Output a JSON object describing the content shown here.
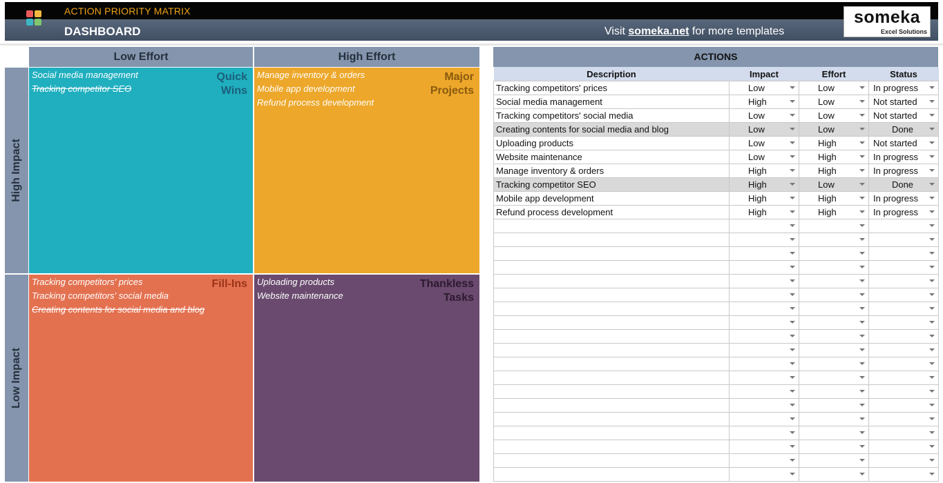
{
  "header": {
    "app_title": "ACTION PRIORITY MATRIX",
    "page_title": "DASHBOARD",
    "promo_prefix": "Visit ",
    "promo_link": "someka.net",
    "promo_suffix": " for more templates",
    "brand_name": "someka",
    "brand_sub": "Excel Solutions",
    "accent_color": "#f0a316",
    "header_color": "#4a596c"
  },
  "matrix": {
    "columns": [
      "Low Effort",
      "High Effort"
    ],
    "rows": [
      "High Impact",
      "Low Impact"
    ],
    "quadrants": [
      {
        "title": "Quick Wins",
        "color": "#20afbf",
        "title_color": "#1b5f7a",
        "items": [
          {
            "text": "Social media management",
            "done": false
          },
          {
            "text": "Tracking competitor SEO",
            "done": true
          }
        ]
      },
      {
        "title": "Major Projects",
        "color": "#eda72a",
        "title_color": "#8a5a10",
        "items": [
          {
            "text": "Manage inventory & orders",
            "done": false
          },
          {
            "text": "Mobile app development",
            "done": false
          },
          {
            "text": "Refund process development",
            "done": false
          }
        ]
      },
      {
        "title": "Fill-Ins",
        "color": "#e37150",
        "title_color": "#9b3418",
        "items": [
          {
            "text": "Tracking competitors' prices",
            "done": false
          },
          {
            "text": "Tracking competitors' social media",
            "done": false
          },
          {
            "text": "Creating contents for social media and blog",
            "done": true
          }
        ]
      },
      {
        "title": "Thankless Tasks",
        "color": "#6a4a6e",
        "title_color": "#2d1a30",
        "items": [
          {
            "text": "Uploading products",
            "done": false
          },
          {
            "text": "Website maintenance",
            "done": false
          }
        ]
      }
    ]
  },
  "actions": {
    "title": "ACTIONS",
    "columns": [
      "Description",
      "Impact",
      "Effort",
      "Status"
    ],
    "rows": [
      {
        "description": "Tracking competitors' prices",
        "impact": "Low",
        "effort": "Low",
        "status": "In progress"
      },
      {
        "description": "Social media management",
        "impact": "High",
        "effort": "Low",
        "status": "Not started"
      },
      {
        "description": "Tracking competitors' social media",
        "impact": "Low",
        "effort": "Low",
        "status": "Not started"
      },
      {
        "description": "Creating contents for social media and blog",
        "impact": "Low",
        "effort": "Low",
        "status": "Done"
      },
      {
        "description": "Uploading products",
        "impact": "Low",
        "effort": "High",
        "status": "Not started"
      },
      {
        "description": "Website maintenance",
        "impact": "Low",
        "effort": "High",
        "status": "In progress"
      },
      {
        "description": "Manage inventory & orders",
        "impact": "High",
        "effort": "High",
        "status": "In progress"
      },
      {
        "description": "Tracking competitor SEO",
        "impact": "High",
        "effort": "Low",
        "status": "Done"
      },
      {
        "description": "Mobile app development",
        "impact": "High",
        "effort": "High",
        "status": "In progress"
      },
      {
        "description": "Refund process development",
        "impact": "High",
        "effort": "High",
        "status": "In progress"
      }
    ],
    "done_row_color": "#d9d9d9"
  }
}
